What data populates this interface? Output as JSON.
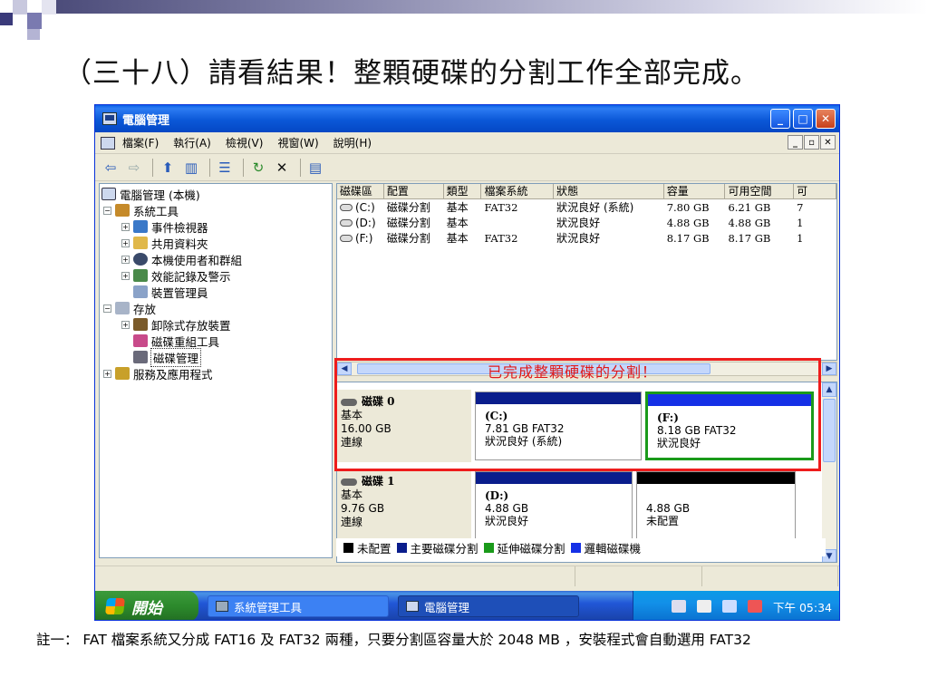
{
  "slide": {
    "title": "（三十八）請看結果！整顆硬碟的分割工作全部完成。",
    "footnote": "註一： FAT 檔案系統又分成 FAT16 及 FAT32 兩種，只要分割區容量大於 2048 MB ，安裝程式會自動選用 FAT32"
  },
  "window": {
    "title": "電腦管理",
    "buttons": {
      "minimize": "_",
      "maximize": "□",
      "close": "✕"
    }
  },
  "menu": {
    "items": [
      "檔案(F)",
      "執行(A)",
      "檢視(V)",
      "視窗(W)",
      "說明(H)"
    ],
    "mdi": [
      "_",
      "▫",
      "✕"
    ]
  },
  "toolbar": {
    "icons": [
      "back-arrow-icon",
      "forward-arrow-icon",
      "up-folder-icon",
      "show-hide-tree-icon",
      "properties-icon",
      "refresh-icon",
      "delete-icon",
      "help-icon"
    ]
  },
  "tree": {
    "items": [
      {
        "label": "電腦管理 (本機)",
        "expander": "",
        "icon": "computer-icon"
      },
      {
        "label": "系統工具",
        "expander": "−",
        "icon": "tools-icon"
      },
      {
        "label": "事件檢視器",
        "expander": "+",
        "icon": "event-viewer-icon"
      },
      {
        "label": "共用資料夾",
        "expander": "+",
        "icon": "shared-folder-icon"
      },
      {
        "label": "本機使用者和群組",
        "expander": "+",
        "icon": "users-icon"
      },
      {
        "label": "效能記錄及警示",
        "expander": "+",
        "icon": "performance-icon"
      },
      {
        "label": "裝置管理員",
        "expander": "",
        "icon": "device-manager-icon"
      },
      {
        "label": "存放",
        "expander": "−",
        "icon": "storage-icon"
      },
      {
        "label": "卸除式存放裝置",
        "expander": "+",
        "icon": "removable-storage-icon"
      },
      {
        "label": "磁碟重組工具",
        "expander": "",
        "icon": "defrag-icon"
      },
      {
        "label": "磁碟管理",
        "expander": "",
        "icon": "disk-management-icon"
      },
      {
        "label": "服務及應用程式",
        "expander": "+",
        "icon": "services-icon"
      }
    ]
  },
  "volumes": {
    "headers": [
      "磁碟區",
      "配置",
      "類型",
      "檔案系統",
      "狀態",
      "容量",
      "可用空間",
      "可"
    ],
    "rows": [
      [
        "(C:)",
        "磁碟分割",
        "基本",
        "FAT32",
        "狀況良好 (系統)",
        "7.80 GB",
        "6.21 GB",
        "7"
      ],
      [
        "(D:)",
        "磁碟分割",
        "基本",
        "",
        "狀況良好",
        "4.88 GB",
        "4.88 GB",
        "1"
      ],
      [
        "(F:)",
        "磁碟分割",
        "基本",
        "FAT32",
        "狀況良好",
        "8.17 GB",
        "8.17 GB",
        "1"
      ]
    ]
  },
  "disks": [
    {
      "name": "磁碟 0",
      "type": "基本",
      "size": "16.00 GB",
      "status": "連線",
      "partitions": [
        {
          "letter": "(C:)",
          "detail": "7.81 GB FAT32",
          "status": "狀況良好 (系統)",
          "bar_color": "#0a1d8c"
        },
        {
          "letter": "(F:)",
          "detail": "8.18 GB FAT32",
          "status": "狀況良好",
          "bar_color": "#1530e6"
        }
      ]
    },
    {
      "name": "磁碟 1",
      "type": "基本",
      "size": "9.76 GB",
      "status": "連線",
      "partitions": [
        {
          "letter": "(D:)",
          "detail": "4.88 GB",
          "status": "狀況良好",
          "bar_color": "#0a1d8c"
        },
        {
          "letter": "",
          "detail": "4.88 GB",
          "status": "未配置",
          "bar_color": "#000000"
        }
      ]
    }
  ],
  "legend": [
    {
      "label": "未配置",
      "color": "#000000"
    },
    {
      "label": "主要磁碟分割",
      "color": "#0a1d8c"
    },
    {
      "label": "延伸磁碟分割",
      "color": "#1a9a1a"
    },
    {
      "label": "邏輯磁碟機",
      "color": "#1530e6"
    }
  ],
  "annotation": {
    "text": "已完成整顆硬碟的分割！",
    "color": "#e01818"
  },
  "taskbar": {
    "start": "開始",
    "tasks": [
      "系統管理工具",
      "電腦管理"
    ],
    "clock": "下午 05:34"
  }
}
